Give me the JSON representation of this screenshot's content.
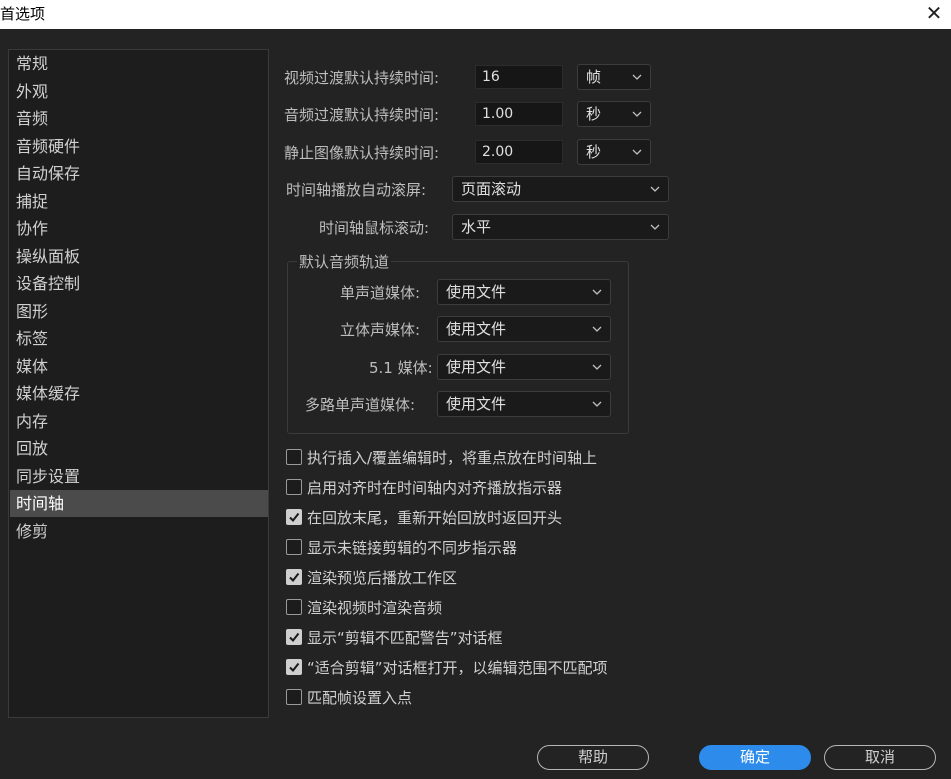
{
  "window": {
    "title": "首选项"
  },
  "sidebar": {
    "items": [
      "常规",
      "外观",
      "音频",
      "音频硬件",
      "自动保存",
      "捕捉",
      "协作",
      "操纵面板",
      "设备控制",
      "图形",
      "标签",
      "媒体",
      "媒体缓存",
      "内存",
      "回放",
      "同步设置",
      "时间轴",
      "修剪"
    ],
    "selected": "时间轴"
  },
  "durations": {
    "video_label": "视频过渡默认持续时间:",
    "video_value": "16",
    "video_unit": "帧",
    "audio_label": "音频过渡默认持续时间:",
    "audio_value": "1.00",
    "audio_unit": "秒",
    "still_label": "静止图像默认持续时间:",
    "still_value": "2.00",
    "still_unit": "秒"
  },
  "timeline": {
    "autoscroll_label": "时间轴播放自动滚屏:",
    "autoscroll_value": "页面滚动",
    "mousescroll_label": "时间轴鼠标滚动:",
    "mousescroll_value": "水平"
  },
  "audio_tracks": {
    "title": "默认音频轨道",
    "mono_label": "单声道媒体:",
    "mono_value": "使用文件",
    "stereo_label": "立体声媒体:",
    "stereo_value": "使用文件",
    "surround_label": "5.1 媒体:",
    "surround_value": "使用文件",
    "multimono_label": "多路单声道媒体:",
    "multimono_value": "使用文件"
  },
  "options": [
    {
      "label": "执行插入/覆盖编辑时，将重点放在时间轴上",
      "checked": false
    },
    {
      "label": "启用对齐时在时间轴内对齐播放指示器",
      "checked": false
    },
    {
      "label": "在回放末尾，重新开始回放时返回开头",
      "checked": true
    },
    {
      "label": "显示未链接剪辑的不同步指示器",
      "checked": false
    },
    {
      "label": "渲染预览后播放工作区",
      "checked": true
    },
    {
      "label": "渲染视频时渲染音频",
      "checked": false
    },
    {
      "label": "显示“剪辑不匹配警告”对话框",
      "checked": true
    },
    {
      "label": "“适合剪辑”对话框打开，以编辑范围不匹配项",
      "checked": true
    },
    {
      "label": "匹配帧设置入点",
      "checked": false
    }
  ],
  "buttons": {
    "help": "帮助",
    "ok": "确定",
    "cancel": "取消"
  },
  "icons": {
    "close": "close-icon",
    "chevron": "chevron-down-icon",
    "check": "checkmark-icon"
  },
  "colors": {
    "accent": "#2d8ceb",
    "background": "#232323",
    "selected": "#4b4b4b"
  }
}
